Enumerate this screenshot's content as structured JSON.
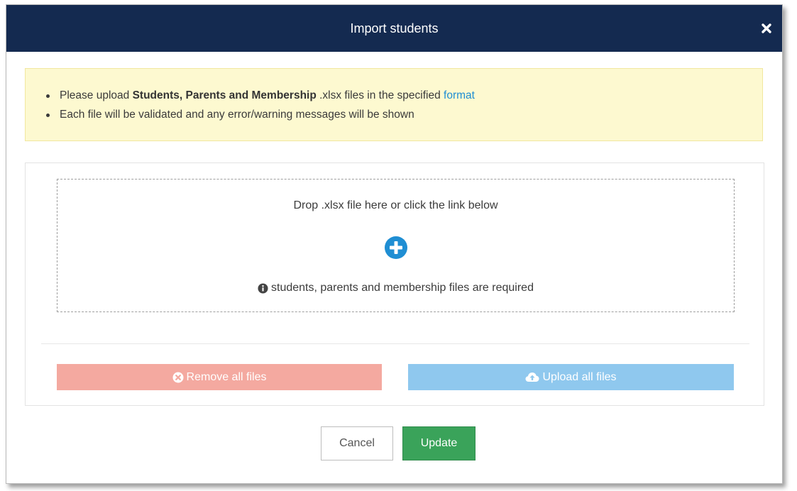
{
  "modal": {
    "title": "Import students",
    "close_icon": "close-x-icon"
  },
  "notice": {
    "line1_prefix": "Please upload ",
    "line1_bold": "Students, Parents and Membership",
    "line1_middle": " .xlsx files in the specified ",
    "line1_link": "format",
    "line2": "Each file will be validated and any error/warning messages will be shown"
  },
  "dropzone": {
    "prompt": "Drop .xlsx file here or click the link below",
    "add_icon": "plus-circle-icon",
    "required_icon": "info-circle-icon",
    "required_text": "students, parents and membership files are required"
  },
  "actions": {
    "remove_label": "Remove all files",
    "remove_icon": "times-circle-icon",
    "upload_label": "Upload all files",
    "upload_icon": "cloud-upload-icon"
  },
  "footer": {
    "cancel_label": "Cancel",
    "update_label": "Update"
  },
  "colors": {
    "header_bg": "#142a50",
    "notice_bg": "#fdf9d0",
    "link": "#1f8ed3",
    "add_icon": "#1f8ed3",
    "remove_btn": "#f4a9a0",
    "upload_btn": "#8fc8ee",
    "update_btn": "#3aa35a"
  }
}
